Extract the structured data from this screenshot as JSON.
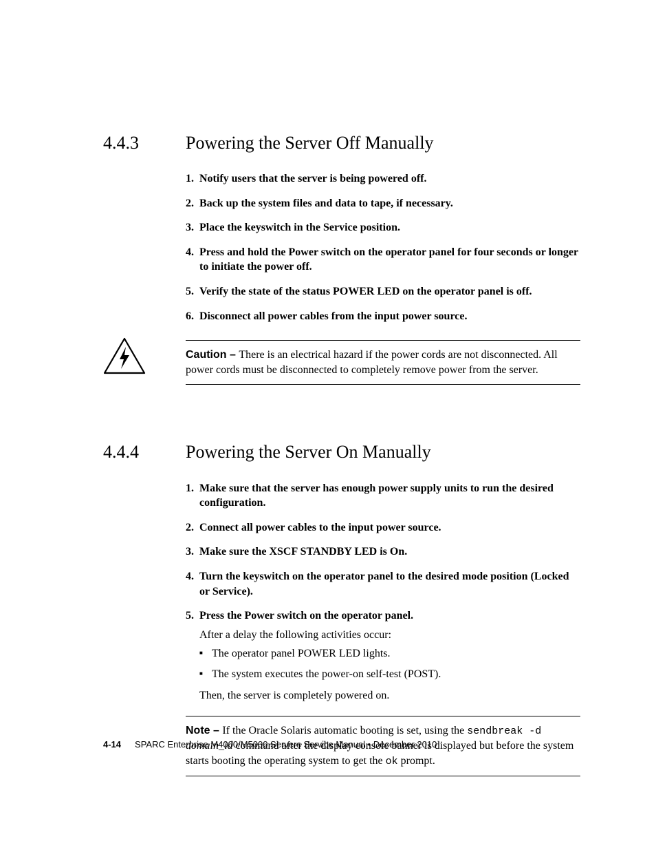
{
  "sec443": {
    "num": "4.4.3",
    "title": "Powering the Server Off Manually",
    "steps": [
      "Notify users that the server is being powered off.",
      "Back up the system files and data to tape, if necessary.",
      "Place the keyswitch in the Service position.",
      "Press and hold the Power switch on the operator panel for four seconds or longer to initiate the power off.",
      "Verify the state of the status POWER LED on the operator panel is off.",
      "Disconnect all power cables from the input power source."
    ],
    "caution_label": "Caution – ",
    "caution_text": "There is an electrical hazard if the power cords are not disconnected. All power cords must be disconnected to completely remove power from the server."
  },
  "sec444": {
    "num": "4.4.4",
    "title": "Powering the Server On Manually",
    "steps": [
      "Make sure that the server has enough power supply units to run the desired configuration.",
      "Connect all power cables to the input power source.",
      "Make sure the XSCF STANDBY LED is On.",
      "Turn the keyswitch on the operator panel to the desired mode position (Locked or Service).",
      "Press the Power switch on the operator panel."
    ],
    "step5_body": "After a delay the following activities occur:",
    "bullets": [
      "The operator panel POWER LED lights.",
      "The system executes the power-on self-test (POST)."
    ],
    "then_line": "Then, the server is completely powered on.",
    "note_label": "Note – ",
    "note_pre": "If the Oracle Solaris automatic booting is set, using the ",
    "note_cmd": "sendbreak -d",
    "note_mid1": " ",
    "note_domain": "domain_id",
    "note_mid2": " command after the display console banner is displayed but before the system starts booting the operating system to get the ",
    "note_ok": "ok",
    "note_post": " prompt."
  },
  "footer": {
    "page": "4-14",
    "text": "SPARC Enterprise M4000/M5000 Servers Service Manual  •  December 2010"
  }
}
